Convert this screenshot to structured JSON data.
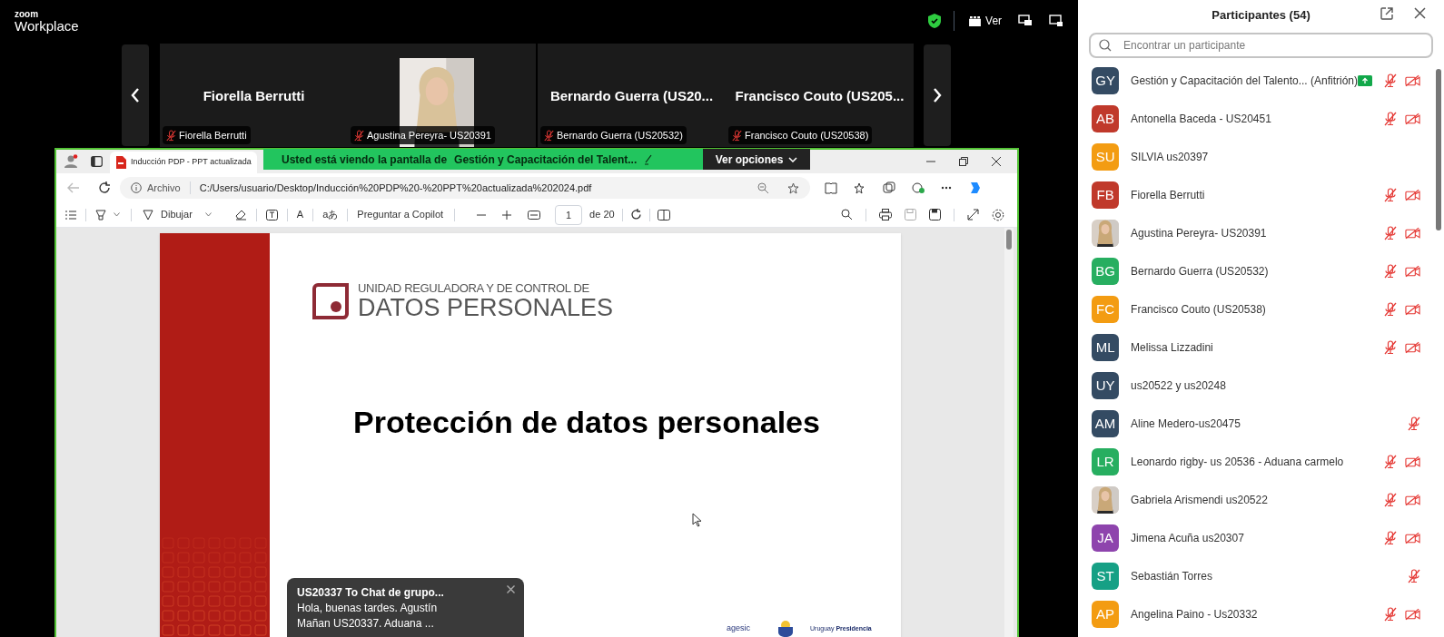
{
  "app": {
    "logo_top": "zoom",
    "logo_bottom": "Workplace"
  },
  "top_bar": {
    "view_button": "Ver"
  },
  "video_strip": {
    "tiles": [
      {
        "kind": "name",
        "name": "Fiorella Berrutti",
        "label": "Fiorella Berrutti",
        "muted": true
      },
      {
        "kind": "picture",
        "label": "Agustina Pereyra- US20391",
        "muted": true
      },
      {
        "kind": "name",
        "name": "Bernardo Guerra (US20...",
        "label": "Bernardo Guerra (US20532)",
        "muted": true
      },
      {
        "kind": "name",
        "name": "Francisco Couto (US205...",
        "label": "Francisco Couto (US20538)",
        "muted": true
      }
    ]
  },
  "share_banner": {
    "text": "Usted está viendo la pantalla de",
    "presenter": "Gestión y Capacitación del Talent...",
    "options_button": "Ver opciones"
  },
  "browser": {
    "tab_title": "Inducción PDP - PPT actualizada",
    "address_label": "Archivo",
    "url": "C:/Users/usuario/Desktop/Inducción%20PDP%20-%20PPT%20actualizada%202024.pdf",
    "draw_button": "Dibujar",
    "read_aloud": "A",
    "translate": "aあ",
    "copilot_button": "Preguntar a Copilot",
    "page": "1",
    "page_count": "de 20"
  },
  "slide": {
    "org_line1": "UNIDAD REGULADORA Y DE CONTROL DE",
    "org_line2": "DATOS PERSONALES",
    "title": "Protección de datos personales",
    "agesic": "agesic",
    "uruguay": "Uruguay **Presidencia**"
  },
  "chat_toast": {
    "title": "US20337 To Chat de grupo...",
    "message_lines": [
      "Hola, buenas tardes. Agustín",
      "Mañan US20337. Aduana ..."
    ]
  },
  "participants": {
    "title": "Participantes (54)",
    "search": {
      "placeholder": "Encontrar un participante"
    },
    "items": [
      {
        "kind": "initials",
        "initials": "GY",
        "color": "#344b63",
        "name": "Gestión y Capacitación del Talento... (Anfitrión)",
        "sharing": true,
        "mic_muted": true,
        "video_off": true
      },
      {
        "kind": "initials",
        "initials": "AB",
        "color": "#c0392b",
        "name": "Antonella Baceda - US20451",
        "sharing": false,
        "mic_muted": true,
        "video_off": true
      },
      {
        "kind": "initials",
        "initials": "SU",
        "color": "#f39c12",
        "name": "SILVIA us20397",
        "sharing": false,
        "mic_muted": false,
        "video_off": false
      },
      {
        "kind": "initials",
        "initials": "FB",
        "color": "#c0392b",
        "name": "Fiorella Berrutti",
        "sharing": false,
        "mic_muted": true,
        "video_off": true
      },
      {
        "kind": "picture",
        "name": "Agustina Pereyra- US20391",
        "sharing": false,
        "mic_muted": true,
        "video_off": true
      },
      {
        "kind": "initials",
        "initials": "BG",
        "color": "#27ae60",
        "name": "Bernardo Guerra (US20532)",
        "sharing": false,
        "mic_muted": true,
        "video_off": true
      },
      {
        "kind": "initials",
        "initials": "FC",
        "color": "#f39c12",
        "name": "Francisco Couto (US20538)",
        "sharing": false,
        "mic_muted": true,
        "video_off": true
      },
      {
        "kind": "initials",
        "initials": "ML",
        "color": "#344b63",
        "name": "Melissa Lizzadini",
        "sharing": false,
        "mic_muted": true,
        "video_off": true
      },
      {
        "kind": "initials",
        "initials": "UY",
        "color": "#344b63",
        "name": "us20522 y us20248",
        "sharing": false,
        "mic_muted": false,
        "video_off": false
      },
      {
        "kind": "initials",
        "initials": "AM",
        "color": "#344b63",
        "name": "Aline Medero-us20475",
        "sharing": false,
        "mic_muted": true,
        "video_off": false
      },
      {
        "kind": "initials",
        "initials": "LR",
        "color": "#27ae60",
        "name": "Leonardo rigby- us 20536 - Aduana carmelo",
        "sharing": false,
        "mic_muted": true,
        "video_off": true
      },
      {
        "kind": "picture",
        "name": "Gabriela Arismendi us20522",
        "sharing": false,
        "mic_muted": true,
        "video_off": true
      },
      {
        "kind": "initials",
        "initials": "JA",
        "color": "#8e44ad",
        "name": "Jimena Acuña us20307",
        "sharing": false,
        "mic_muted": true,
        "video_off": true
      },
      {
        "kind": "initials",
        "initials": "ST",
        "color": "#16a085",
        "name": "Sebastián Torres",
        "sharing": false,
        "mic_muted": true,
        "video_off": false
      },
      {
        "kind": "initials",
        "initials": "AP",
        "color": "#f39c12",
        "name": "Angelina Paino - Us20332",
        "sharing": false,
        "mic_muted": true,
        "video_off": true
      }
    ]
  }
}
